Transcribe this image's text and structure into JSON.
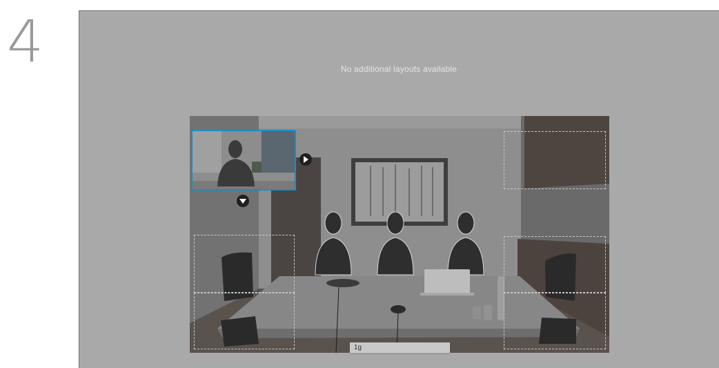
{
  "step": {
    "number": "4"
  },
  "screen": {
    "notice": "No additional layouts available"
  },
  "selfview": {
    "controls": {
      "move_right_icon": "play-right-icon",
      "move_down_icon": "arrow-down-icon"
    }
  },
  "input": {
    "value": "1g"
  },
  "colors": {
    "screen_bg": "#a9a9a9",
    "selfview_border": "#1d8cc4",
    "step_number": "#9a9a9a"
  }
}
